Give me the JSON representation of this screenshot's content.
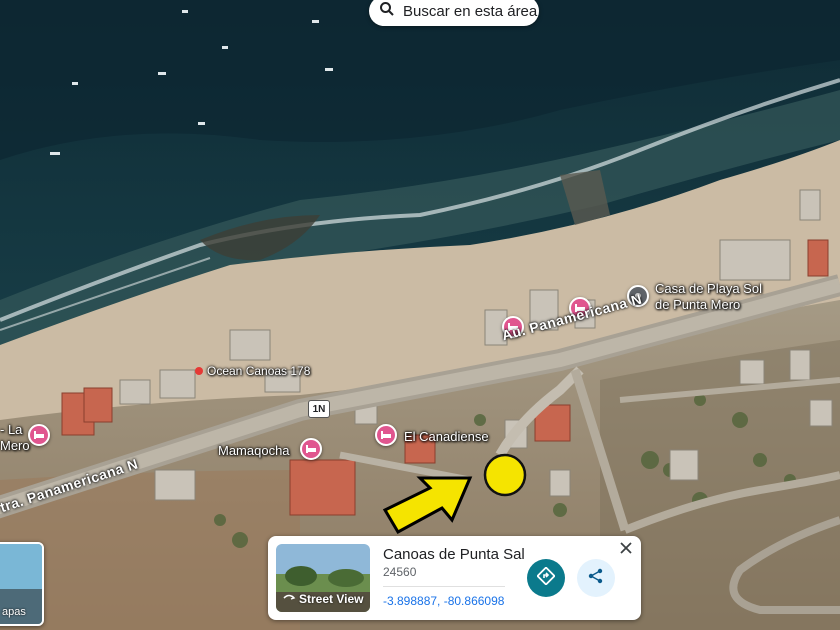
{
  "search_area": {
    "label": "Buscar en esta área",
    "icon": "search-icon"
  },
  "place_labels": {
    "casa_line1": "Casa de Playa Sol",
    "casa_line2": "de Punta Mero",
    "ocean_canoas": "Ocean Canoas 178",
    "el_canadiense": "El Canadiense",
    "mamaqocha": "Mamaqocha",
    "left_line1": "- La",
    "left_line2": "Mero"
  },
  "road_labels": {
    "panamericana_upper": "Au. Panamericana N",
    "panamericana_lower": "tra. Panamericana N",
    "route_shield": "1N"
  },
  "place_card": {
    "title": "Canoas de Punta Sal",
    "postal_code": "24560",
    "coordinates": "-3.898887, -80.866098",
    "street_view_label": "Street View",
    "directions_icon": "directions-icon",
    "share_icon": "share-icon",
    "close_icon": "close-icon"
  },
  "layer_toggle": {
    "label": "apas"
  },
  "colors": {
    "pin_pink": "#e0568f",
    "marker_yellow": "#f5e400",
    "directions_teal": "#0b7a8c",
    "share_bg": "#e3f2fd",
    "ocean": "#17404a",
    "sand": "#cbbba4"
  }
}
